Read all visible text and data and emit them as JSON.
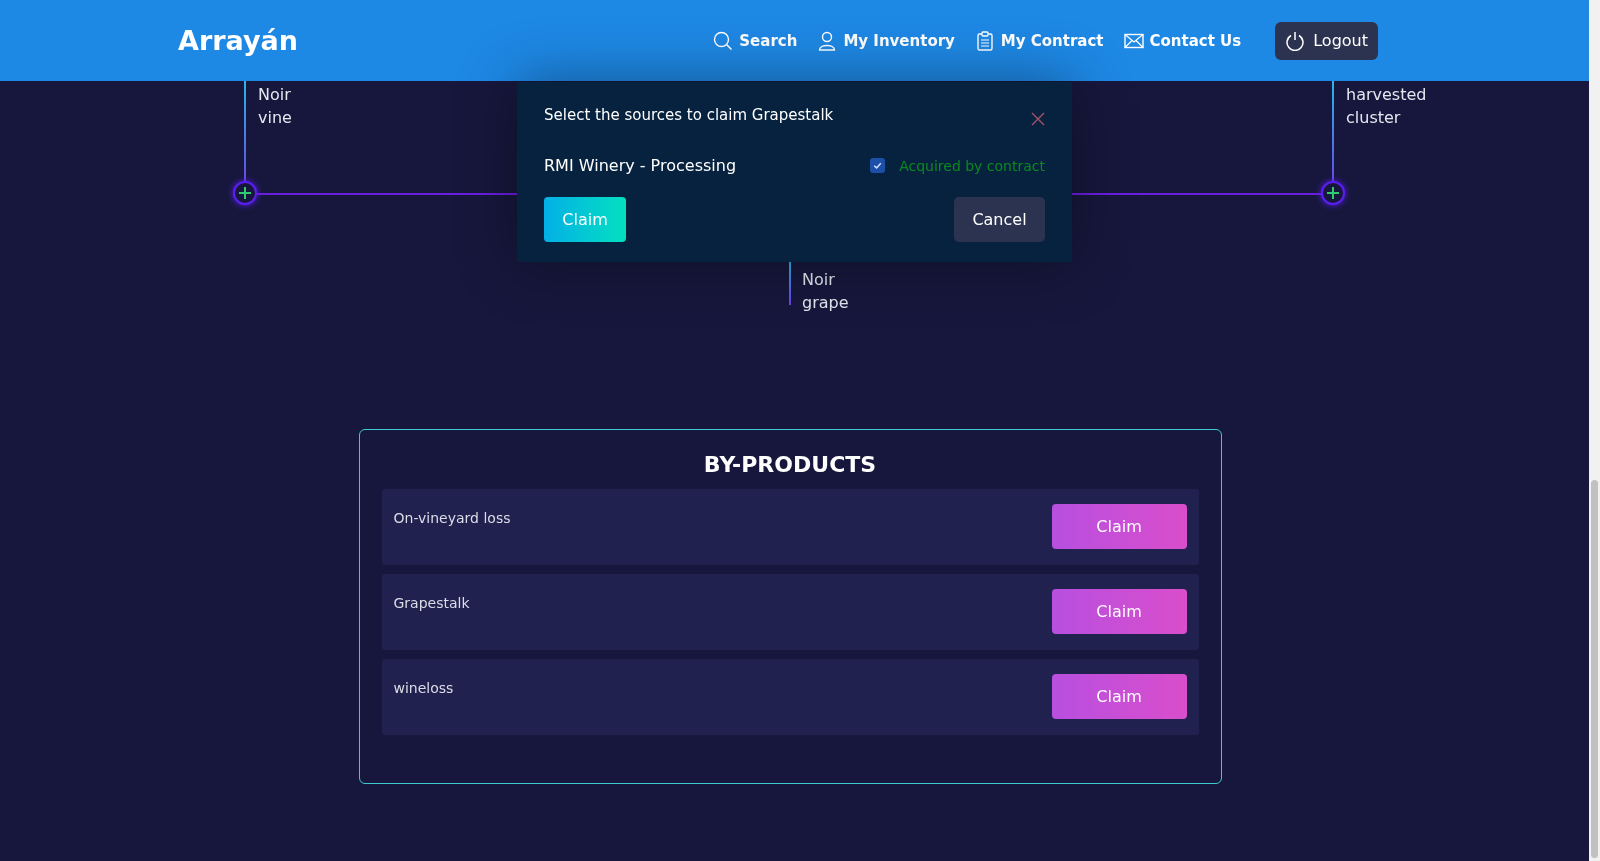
{
  "header": {
    "brand": "Arrayán",
    "nav": [
      {
        "label": "Search"
      },
      {
        "label": "My Inventory"
      },
      {
        "label": "My Contract"
      },
      {
        "label": "Contact Us"
      }
    ],
    "logout": "Logout"
  },
  "tree": {
    "nodes": [
      {
        "lines": [
          "Noir",
          "vine"
        ]
      },
      {
        "lines": [
          "Noir",
          "grape"
        ]
      },
      {
        "lines": [
          "harvested",
          "cluster"
        ]
      }
    ]
  },
  "modal": {
    "title": "Select the sources to claim Grapestalk",
    "sources": [
      {
        "name": "RMI Winery - Processing",
        "checked": true,
        "status": "Acquired by contract"
      }
    ],
    "confirm": "Claim",
    "cancel": "Cancel"
  },
  "by_products": {
    "title": "BY-PRODUCTS",
    "items": [
      {
        "name": "On-vineyard loss",
        "action": "Claim"
      },
      {
        "name": "Grapestalk",
        "action": "Claim"
      },
      {
        "name": "wineloss",
        "action": "Claim"
      }
    ]
  }
}
